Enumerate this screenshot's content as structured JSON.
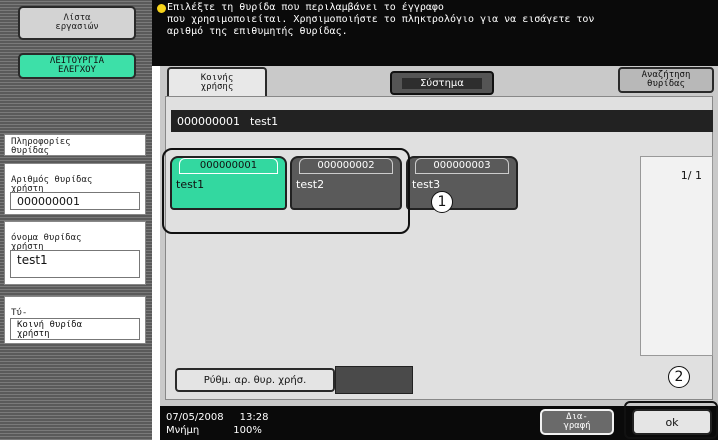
{
  "sidebar": {
    "job_list_btn": "Λίστα\nεργασιών",
    "utility_btn": "ΛΕΙΤΟΥΡΓΙΑ\nΕΛΕΓΧΟΥ",
    "box_info_heading": "Πληροφορίες\nθυρίδας",
    "box_number_label": "Αριθμός θυρίδας\nχρήστη",
    "box_number_value": "000000001",
    "box_name_label": "όνομα θυρίδας\nχρήστη",
    "box_name_value": "test1",
    "type_label": "Τύ-\nπος",
    "type_value": "Κοινή θυρίδα\nχρήστη"
  },
  "message": {
    "text": "Επιλέξτε τη θυρίδα που περιλαμβάνει το έγγραφο\nπου χρησιμοποιείται. Χρησιμοποιήστε το πληκτρολόγιο για να εισάγετε τον\nαριθμό της επιθυμητής θυρίδας."
  },
  "tabs": {
    "public": "Κοινής\nχρήσης",
    "system": "Σύστημα",
    "search": "Αναζήτηση\nθυρίδας"
  },
  "selected_box": {
    "number": "000000001",
    "name": "test1"
  },
  "boxes": [
    {
      "number": "000000001",
      "name": "test1",
      "selected": true
    },
    {
      "number": "000000002",
      "name": "test2",
      "selected": false
    },
    {
      "number": "000000003",
      "name": "test3",
      "selected": false
    }
  ],
  "pagination": {
    "text": "1/  1"
  },
  "footer": {
    "set_box_no_btn": "Ρύθμ. αρ. θυρ. χρήσ.",
    "datetime_date": "07/05/2008",
    "datetime_time": "13:28",
    "memory_label": "Μνήμη",
    "memory_value": "100%",
    "delete_btn": "Δια-\nγραφή",
    "ok_btn": "ok"
  },
  "callouts": [
    "1",
    "2"
  ],
  "colors": {
    "accent_green": "#33d8a0",
    "background_dark": "#0a0a0a",
    "panel_grey": "#c9c9c9"
  }
}
